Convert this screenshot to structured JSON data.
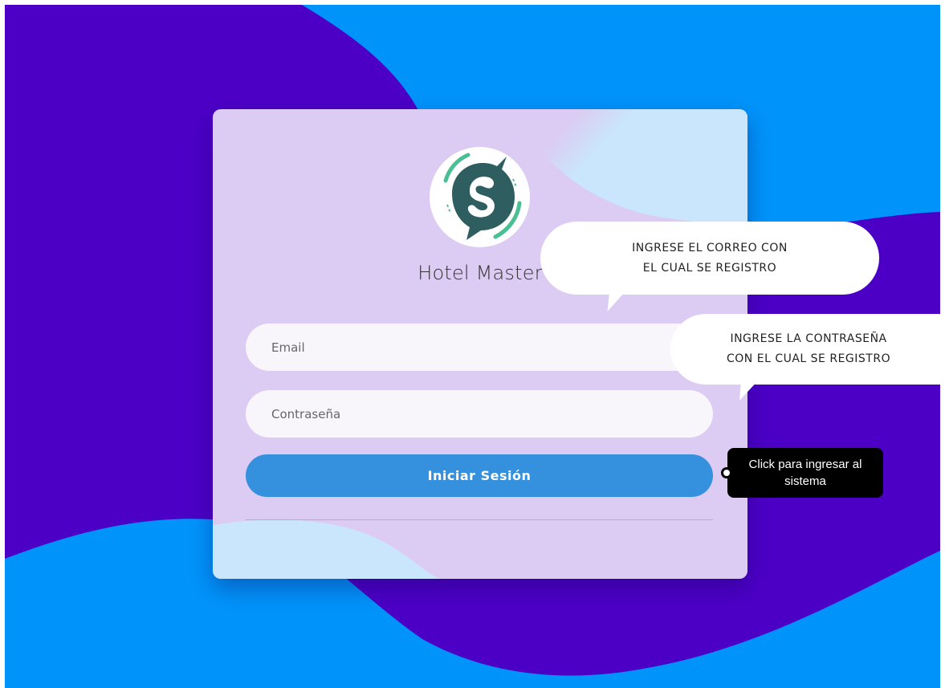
{
  "app": {
    "title": "Hotel Master"
  },
  "login": {
    "email_placeholder": "Email",
    "password_placeholder": "Contraseña",
    "submit_label": "Iniciar Sesión"
  },
  "help": {
    "email_hint": "INGRESE EL CORREO CON\nEL CUAL SE REGISTRO",
    "password_hint": "INGRESE LA CONTRASEÑA\nCON EL CUAL SE REGISTRO",
    "submit_tooltip": "Click para ingresar al\nsistema"
  },
  "colors": {
    "background_purple": "#4c00c6",
    "background_blue": "#0094fb",
    "card_lavender": "#dccbf2",
    "card_light_blue": "#c9e6fc",
    "button_blue": "#3591dd",
    "logo_dark": "#2e5e5f",
    "logo_green": "#4bbf94"
  },
  "icons": {
    "logo": "hotel-master-s-logo-icon"
  }
}
